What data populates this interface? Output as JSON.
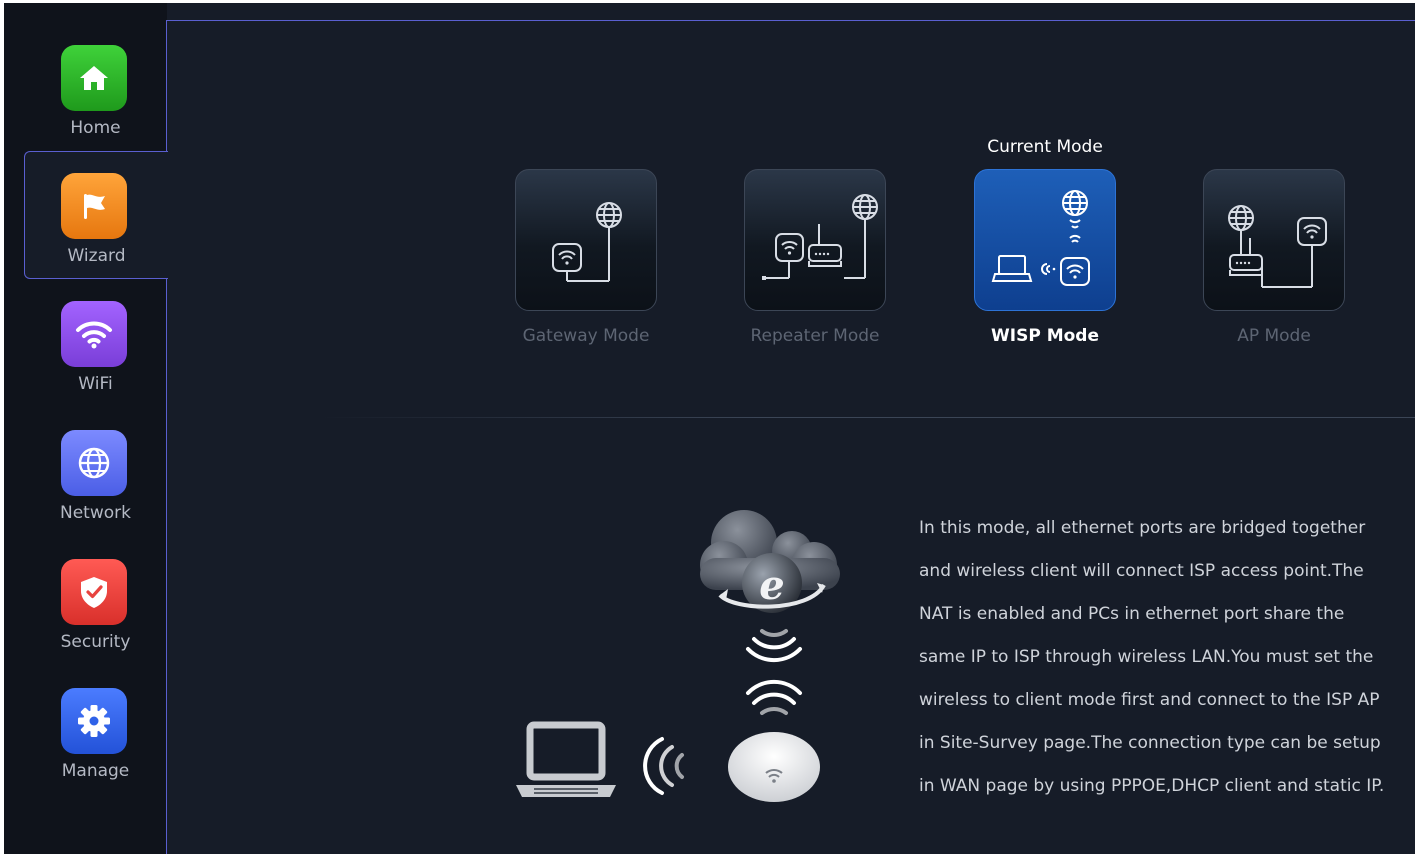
{
  "sidebar": {
    "items": [
      {
        "label": "Home",
        "icon": "home-icon",
        "color": "#2fb32a"
      },
      {
        "label": "Wizard",
        "icon": "flag-icon",
        "color": "#f08a1c",
        "active": true
      },
      {
        "label": "WiFi",
        "icon": "wifi-icon",
        "color": "#8a4ee8"
      },
      {
        "label": "Network",
        "icon": "globe-icon",
        "color": "#5e6ef0"
      },
      {
        "label": "Security",
        "icon": "shield-icon",
        "color": "#e8443f"
      },
      {
        "label": "Manage",
        "icon": "gear-icon",
        "color": "#2f62e8"
      }
    ]
  },
  "modes": {
    "current_caption": "Current Mode",
    "items": [
      {
        "label": "Gateway Mode",
        "current": false
      },
      {
        "label": "Repeater Mode",
        "current": false
      },
      {
        "label": "WISP Mode",
        "current": true
      },
      {
        "label": "AP Mode",
        "current": false
      }
    ]
  },
  "description": "In this mode, all ethernet ports are bridged together and wireless client will connect ISP access point.The NAT is enabled and PCs in ethernet port share the same IP to ISP through wireless LAN.You must set the wireless to client mode first and connect to the ISP AP in Site-Survey page.The connection type can be setup in WAN page by using PPPOE,DHCP client and static IP."
}
